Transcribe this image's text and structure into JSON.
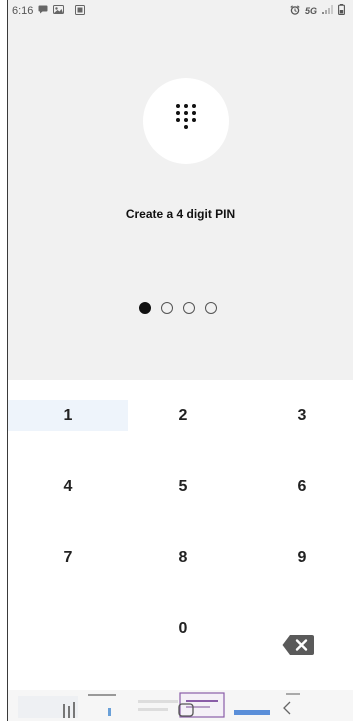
{
  "status_bar": {
    "time": "6:16",
    "network_label": "5G",
    "left_icons": [
      "chat-notification-icon",
      "photo-notification-icon",
      "gallery-notification-icon"
    ],
    "right_icons": [
      "alarm-icon",
      "signal-icon",
      "battery-icon"
    ]
  },
  "pin_setup": {
    "icon": "dialpad-icon",
    "title": "Create a 4 digit PIN",
    "digits_entered": 1,
    "pin_length": 4
  },
  "keypad": {
    "keys": [
      "1",
      "2",
      "3",
      "4",
      "5",
      "6",
      "7",
      "8",
      "9",
      "0"
    ],
    "highlighted_key": "1",
    "backspace_icon": "backspace-icon"
  },
  "colors": {
    "top_panel_bg": "#f1f1f1",
    "keypad_bg": "#ffffff",
    "highlight": "#eef4fb",
    "text": "#222222",
    "backspace": "#5a5a5a"
  }
}
